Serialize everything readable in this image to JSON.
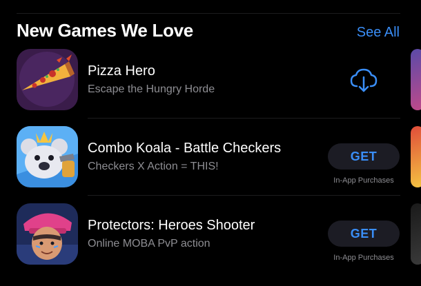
{
  "section": {
    "title": "New Games We Love",
    "see_all": "See All"
  },
  "apps": [
    {
      "title": "Pizza Hero",
      "subtitle": "Escape the Hungry Horde",
      "action": "download-cloud",
      "icon": "pizza-hero-icon"
    },
    {
      "title": "Combo Koala - Battle Checkers",
      "subtitle": "Checkers X Action = THIS!",
      "action": "GET",
      "iap": "In-App Purchases",
      "icon": "combo-koala-icon"
    },
    {
      "title": "Protectors: Heroes Shooter",
      "subtitle": "Online MOBA PvP action",
      "action": "GET",
      "iap": "In-App Purchases",
      "icon": "protectors-icon"
    }
  ],
  "colors": {
    "background": "#000000",
    "accent": "#3a8ef7",
    "secondary_text": "#8e8e93",
    "button_bg": "#1c1c24"
  }
}
